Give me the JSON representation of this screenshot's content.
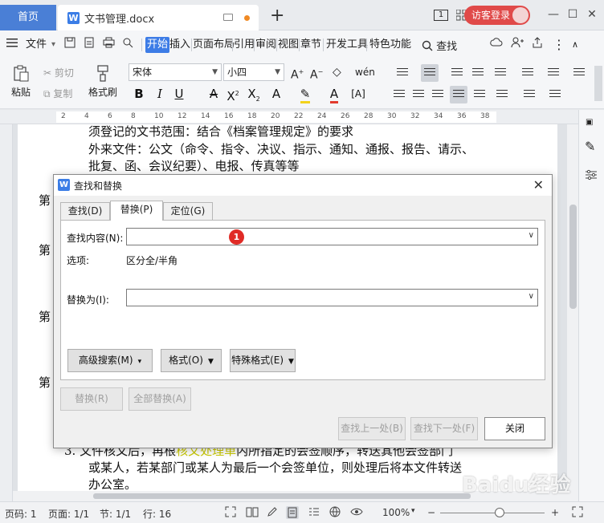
{
  "titlebar": {
    "home_tab": "首页",
    "doc_icon": "W",
    "doc_title": "文书管理.docx",
    "new_tab": "+",
    "page_count": "1",
    "login_label": "访客登录",
    "window": {
      "minimize": "—",
      "maximize": "☐",
      "close": "✕"
    }
  },
  "menu": {
    "file": "文件",
    "items": [
      "开始",
      "插入",
      "页面布局",
      "引用",
      "审阅",
      "视图",
      "章节",
      "开发工具",
      "特色功能"
    ],
    "search": "查找"
  },
  "ribbon": {
    "paste": "粘贴",
    "cut": "剪切",
    "copy": "复制",
    "format_painter": "格式刷",
    "font_name": "宋体",
    "font_size": "小四"
  },
  "ruler": {
    "numbers": [
      "2",
      "4",
      "6",
      "8",
      "10",
      "12",
      "14",
      "16",
      "18",
      "20",
      "22",
      "24",
      "26",
      "28",
      "30",
      "32",
      "34",
      "36",
      "38"
    ]
  },
  "document": {
    "lines": [
      "须登记的文书范围：结合《档案管理规定》的要求",
      "外来文件：公文（命令、指令、决议、指示、通知、通报、报告、请示、",
      "批复、函、会议纪要）、电报、传真等等",
      "第",
      "第",
      "第",
      "第",
      "或某人，若某部门或某人为最后一个会签单位，则处理后将本文件转送",
      "办公室。"
    ],
    "line_partial_prefix": "3. 文件核文后，再根",
    "line_partial_yellow": "核文处理单",
    "line_partial_suffix": "内所指定的会签顺序，转送其他会签部门"
  },
  "dialog": {
    "title": "查找和替换",
    "tabs": [
      "查找(D)",
      "替换(P)",
      "定位(G)"
    ],
    "find_label": "查找内容(N):",
    "find_value": "",
    "badge": "1",
    "options_label": "选项:",
    "options_value": "区分全/半角",
    "replace_label": "替换为(I):",
    "replace_value": "",
    "advanced_search": "高级搜索(M)",
    "format": "格式(O)",
    "special_format": "特殊格式(E)",
    "replace": "替换(R)",
    "replace_all": "全部替换(A)",
    "find_prev": "查找上一处(B)",
    "find_next": "查找下一处(F)",
    "close": "关闭"
  },
  "statusbar": {
    "page_code": "页码: 1",
    "page": "页面: 1/1",
    "section": "节: 1/1",
    "row": "行: 16",
    "zoom": "100%"
  },
  "watermark": "Baidu经验"
}
